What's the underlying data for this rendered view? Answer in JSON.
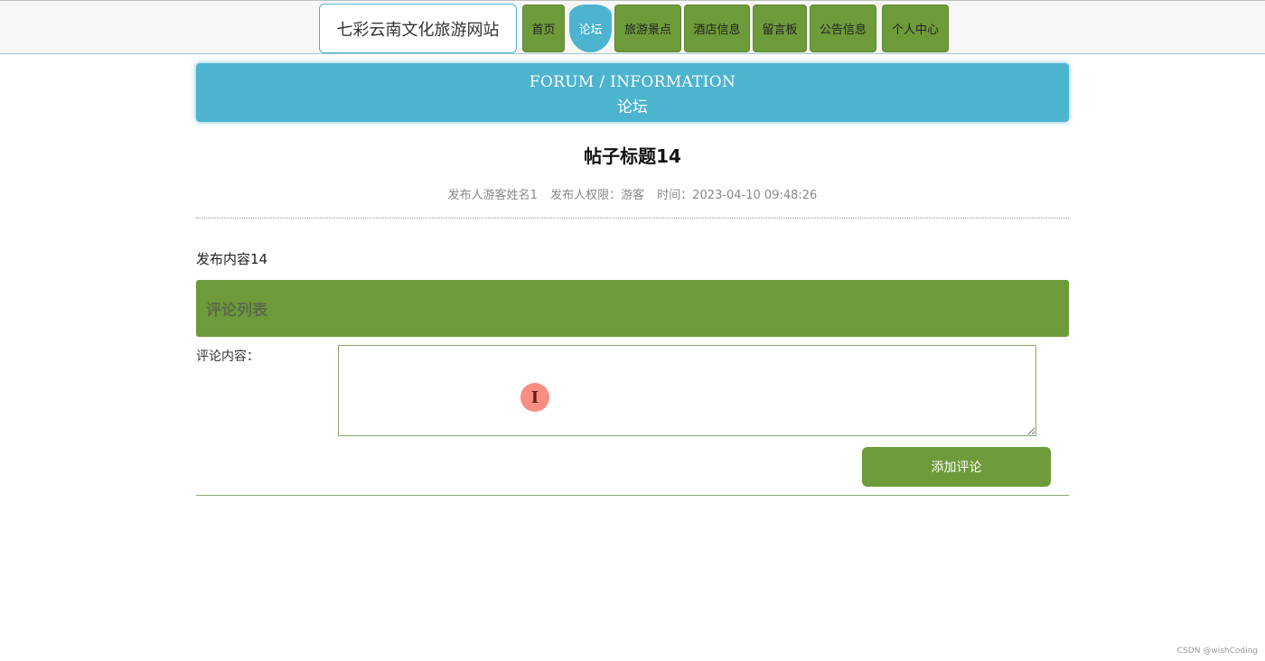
{
  "site": {
    "title": "七彩云南文化旅游网站"
  },
  "nav": {
    "items": [
      {
        "label": "首页",
        "active": false
      },
      {
        "label": "论坛",
        "active": true
      },
      {
        "label": "旅游景点",
        "active": false
      },
      {
        "label": "酒店信息",
        "active": false
      },
      {
        "label": "留言板",
        "active": false
      },
      {
        "label": "公告信息",
        "active": false
      },
      {
        "label": "个人中心",
        "active": false
      }
    ]
  },
  "banner": {
    "title_en": "FORUM / INFORMATION",
    "title_zh": "论坛"
  },
  "post": {
    "title": "帖子标题14",
    "author": "发布人游客姓名1",
    "role": "发布人权限：游客",
    "time": "时间：2023-04-10 09:48:26",
    "content": "发布内容14"
  },
  "comments": {
    "header": "评论列表",
    "input_label": "评论内容：",
    "input_value": "",
    "submit_label": "添加评论"
  },
  "cursor": {
    "glyph": "I"
  },
  "watermark": "CSDN @wishCoding",
  "colors": {
    "accent_blue": "#4db4cf",
    "accent_green": "#6e9b3a"
  }
}
